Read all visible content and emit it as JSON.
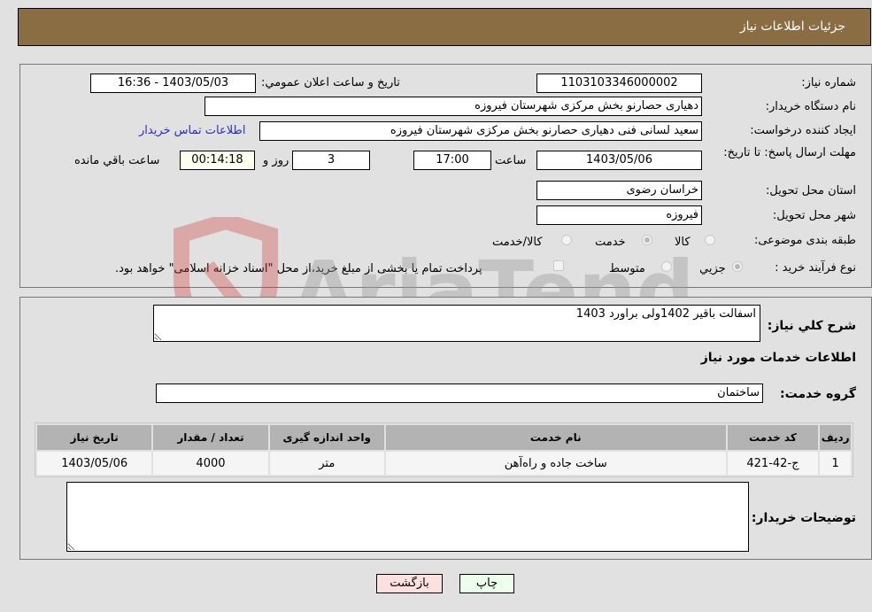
{
  "header": {
    "title": "جزئیات اطلاعات نیاز"
  },
  "info": {
    "need_number": {
      "label": "شماره نیاز:",
      "value": "1103103346000002"
    },
    "announce_datetime": {
      "label": "تاریخ و ساعت اعلان عمومي:",
      "value": "1403/05/03 - 16:36"
    },
    "buyer_org": {
      "label": "نام دستگاه خريدار:",
      "value": "دهیاری حصارنو بخش مرکزی شهرستان فیروزه"
    },
    "creator": {
      "label": "ايجاد كننده درخواست:",
      "value": "سعید لسانی فنی دهیاری حصارنو بخش مرکزی شهرستان فیروزه"
    },
    "contact_link": "اطلاعات تماس خريدار",
    "deadline": {
      "label": "مهلت ارسال پاسخ: تا تاريخ:",
      "date": "1403/05/06",
      "time_label": "ساعت",
      "time": "17:00",
      "days": "3",
      "days_label": "روز و",
      "remaining": "00:14:18",
      "remaining_label": "ساعت باقي مانده"
    },
    "province": {
      "label": "استان محل تحويل:",
      "value": "خراسان رضوی"
    },
    "city": {
      "label": "شهر محل تحويل:",
      "value": "فیروزه"
    },
    "category": {
      "label": "طبقه بندی موضوعی:",
      "options": [
        "كالا",
        "خدمت",
        "كالا/خدمت"
      ],
      "selected": "خدمت"
    },
    "purchase_type": {
      "label": "نوع فرآيند خريد :",
      "options": [
        "جزيي",
        "متوسط"
      ],
      "selected": "جزيي",
      "treasury_note": "پرداخت تمام يا بخشی از مبلغ خريد،از محل \"اسناد خزانه اسلامی\" خواهد بود."
    }
  },
  "details": {
    "summary_label": "شرح كلي نياز:",
    "summary_value": "اسفالت باقیر 1402ولی براورد 1403",
    "services_heading": "اطلاعات خدمات مورد نياز",
    "service_group_label": "گروه خدمت:",
    "service_group_value": "ساختمان",
    "table": {
      "headers": [
        "رديف",
        "كد خدمت",
        "نام خدمت",
        "واحد اندازه گيری",
        "تعداد / مقدار",
        "تاريخ نياز"
      ],
      "rows": [
        [
          "1",
          "ج-42-421",
          "ساخت جاده و راه‌آهن",
          "متر",
          "4000",
          "1403/05/06"
        ]
      ]
    },
    "buyer_notes_label": "توضيحات خريدار:",
    "buyer_notes_value": ""
  },
  "buttons": {
    "print": "چاپ",
    "back": "بازگشت"
  },
  "watermark": {
    "text": "AriaTender.neT"
  }
}
